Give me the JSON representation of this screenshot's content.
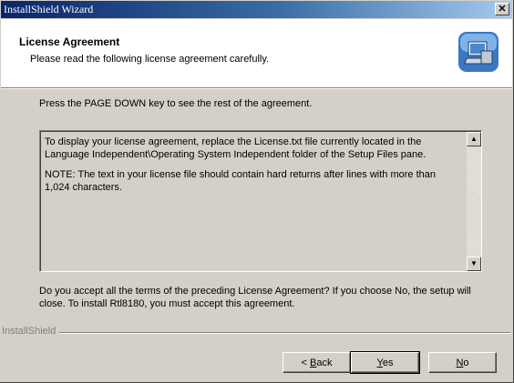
{
  "window": {
    "title": "InstallShield Wizard",
    "close_glyph": "✕"
  },
  "header": {
    "title": "License Agreement",
    "subtitle": "Please read the following license agreement carefully.",
    "icon": "installer-computer-icon"
  },
  "instruction": "Press the PAGE DOWN key to see the rest of the agreement.",
  "license": {
    "paragraph1": "To display your license agreement, replace the License.txt file currently located in the Language Independent\\Operating System Independent folder of the Setup Files pane.",
    "paragraph2": "NOTE: The text in your license file should contain hard returns after lines with more than 1,024 characters.",
    "scroll_up_glyph": "▲",
    "scroll_down_glyph": "▼"
  },
  "question": "Do you accept all the terms of the preceding License Agreement?  If you choose No,  the setup will close.  To install Rtl8180, you must accept this agreement.",
  "brand": "InstallShield",
  "buttons": {
    "back_prefix": "< ",
    "back_key": "B",
    "back_rest": "ack",
    "yes_key": "Y",
    "yes_rest": "es",
    "no_key": "N",
    "no_rest": "o"
  },
  "colors": {
    "titlebar_start": "#0a246a",
    "titlebar_end": "#a6caf0",
    "face": "#d4d0c8"
  }
}
